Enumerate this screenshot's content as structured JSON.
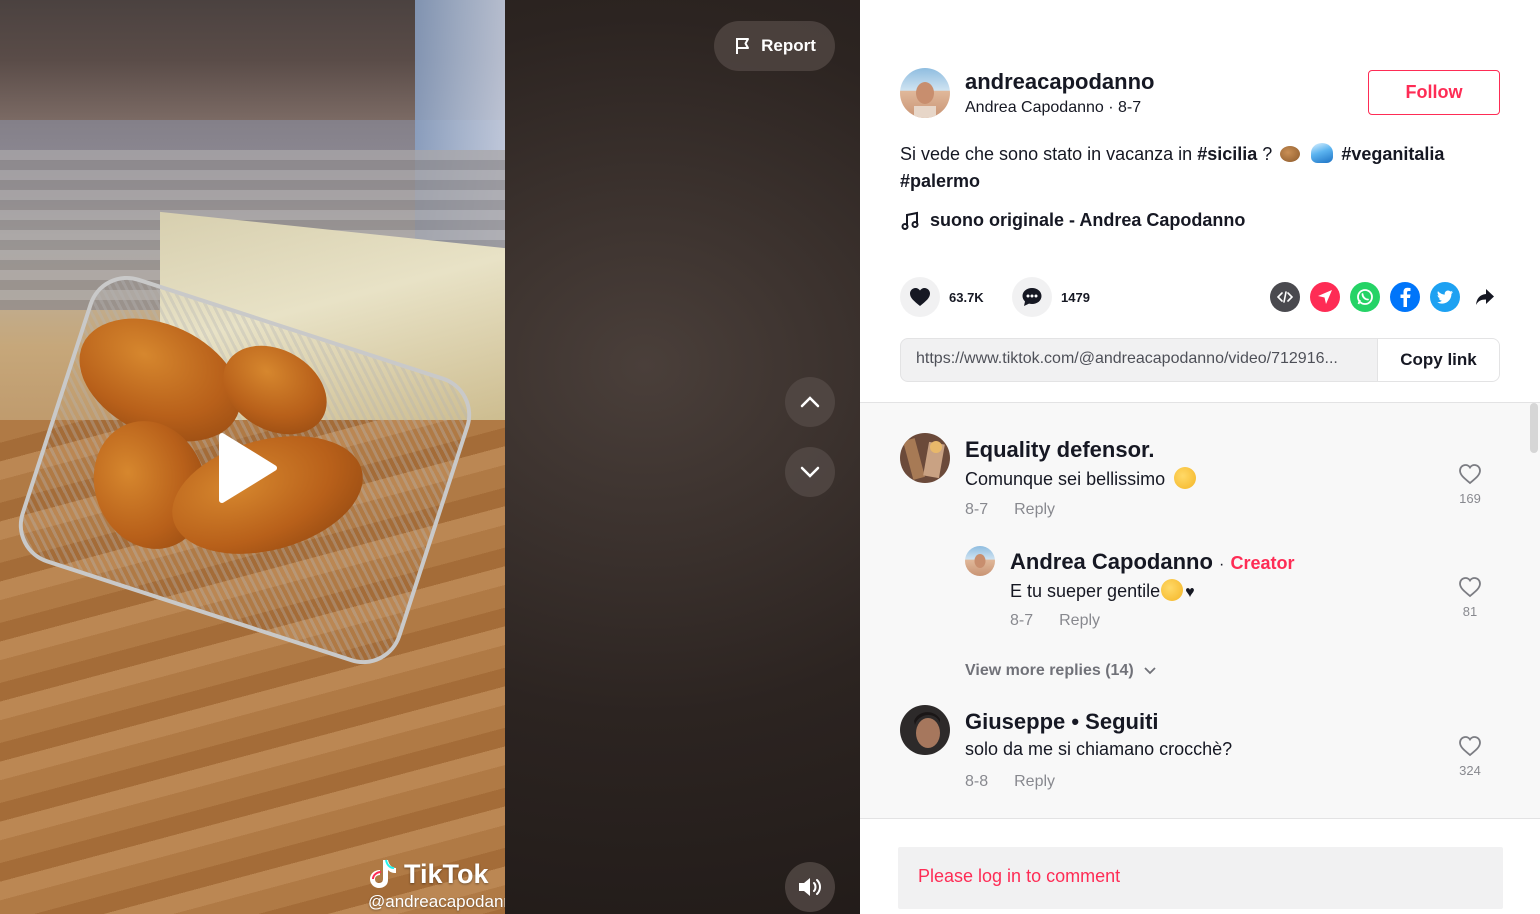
{
  "video": {
    "report_label": "Report",
    "watermark_brand": "TikTok",
    "watermark_handle": "@andreacapodanno"
  },
  "author": {
    "username": "andreacapodanno",
    "display_name": "Andrea Capodanno",
    "date": "8-7",
    "follow_label": "Follow"
  },
  "caption": {
    "text": "Si vede che sono stato in vacanza in",
    "hashtags": [
      "#sicilia",
      "#veganitalia",
      "#palermo"
    ],
    "separator": "?"
  },
  "music": {
    "label": "suono originale - Andrea Capodanno"
  },
  "stats": {
    "likes": "63.7K",
    "comments": "1479"
  },
  "share": {
    "icons": [
      "embed-icon",
      "send-icon",
      "whatsapp-icon",
      "facebook-icon",
      "twitter-icon",
      "share-arrow-icon"
    ],
    "colors": {
      "embed": "#4a4a4f",
      "send": "#fe2c55",
      "whatsapp": "#25d366",
      "facebook": "#0075fa",
      "twitter": "#1da1f2"
    }
  },
  "link": {
    "url": "https://www.tiktok.com/@andreacapodanno/video/712916...",
    "copy_label": "Copy link"
  },
  "comments": [
    {
      "name": "Equality defensor.",
      "text": "Comunque sei bellissimo",
      "date": "8-7",
      "reply_label": "Reply",
      "likes": "169"
    },
    {
      "name": "Giuseppe • Seguiti",
      "text": "solo da me si chiamano crocchè?",
      "date": "8-8",
      "reply_label": "Reply",
      "likes": "324"
    }
  ],
  "reply": {
    "name": "Andrea Capodanno",
    "badge_separator": "·",
    "badge": "Creator",
    "text": "E tu sueper gentile",
    "date": "8-7",
    "reply_label": "Reply",
    "likes": "81"
  },
  "view_more_replies": "View more replies (14)",
  "login_prompt": "Please log in to comment",
  "theme": {
    "accent": "#fe2c55",
    "text": "#161823"
  }
}
